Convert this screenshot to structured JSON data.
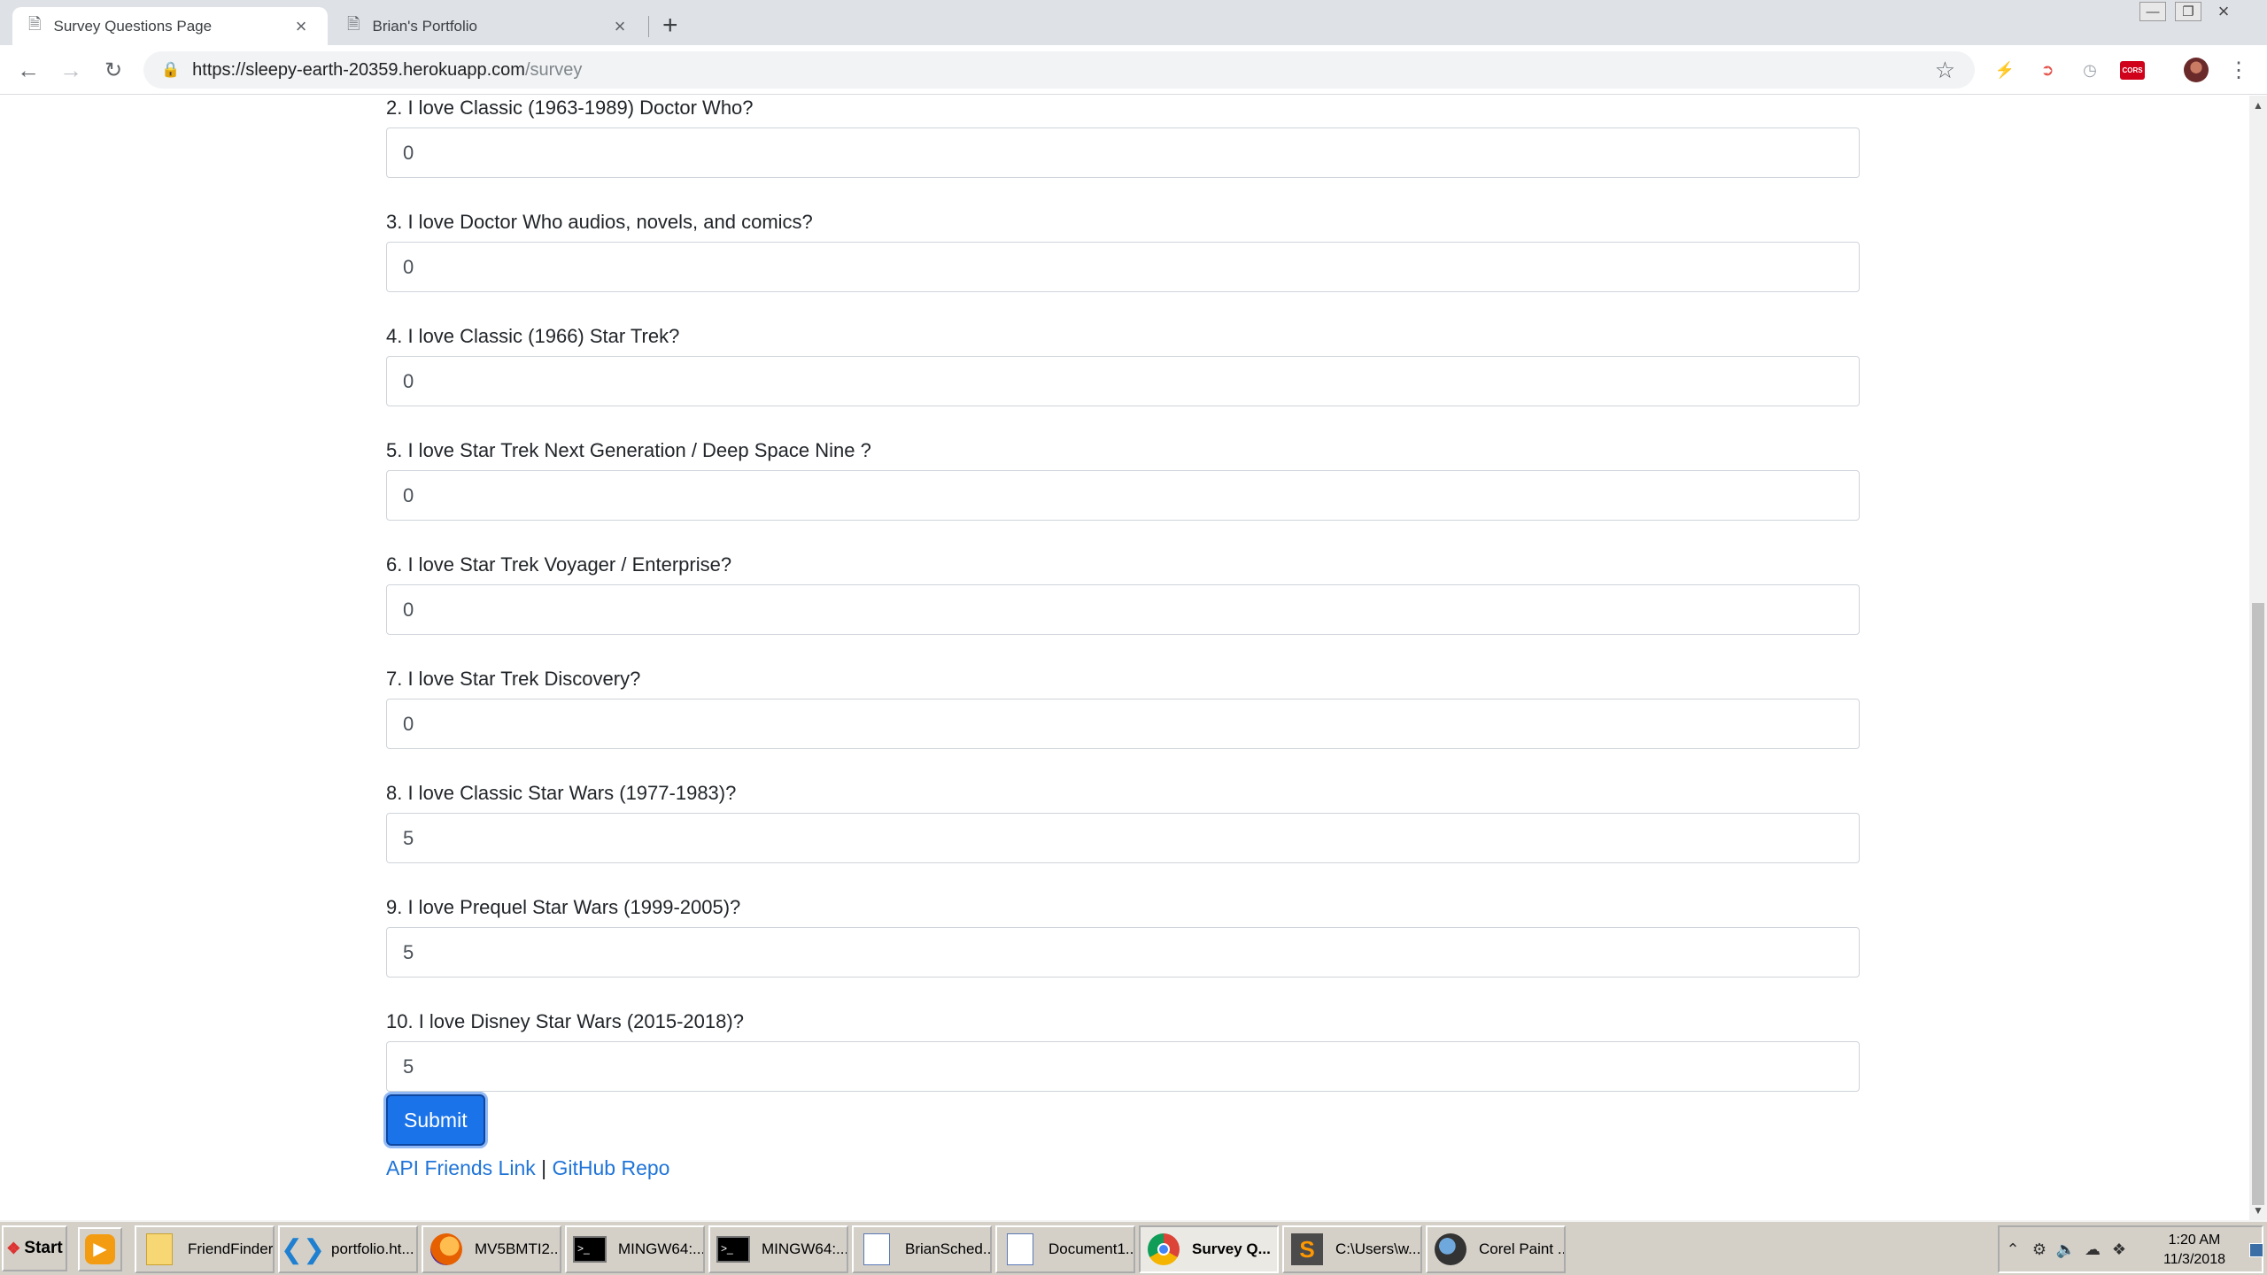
{
  "browser": {
    "tabs": [
      {
        "title": "Survey Questions Page",
        "active": true
      },
      {
        "title": "Brian's Portfolio",
        "active": false
      }
    ],
    "new_tab_label": "+",
    "url_host": "https://sleepy-earth-20359.herokuapp.com",
    "url_path": "/survey",
    "extensions": [
      "bolt-icon",
      "arrow-icon",
      "clock-icon",
      "cors-icon",
      "avatar"
    ],
    "cors_label": "CORS"
  },
  "survey": {
    "questions": [
      {
        "label": "2. I love Classic (1963-1989) Doctor Who?",
        "value": "0"
      },
      {
        "label": "3. I love Doctor Who audios, novels, and comics?",
        "value": "0"
      },
      {
        "label": "4. I love Classic (1966) Star Trek?",
        "value": "0"
      },
      {
        "label": "5. I love Star Trek Next Generation / Deep Space Nine ?",
        "value": "0"
      },
      {
        "label": "6. I love Star Trek Voyager / Enterprise?",
        "value": "0"
      },
      {
        "label": "7. I love Star Trek Discovery?",
        "value": "0"
      },
      {
        "label": "8. I love Classic Star Wars (1977-1983)?",
        "value": "5"
      },
      {
        "label": "9. I love Prequel Star Wars (1999-2005)?",
        "value": "5"
      },
      {
        "label": "10. I love Disney Star Wars (2015-2018)?",
        "value": "5"
      }
    ],
    "submit_label": "Submit",
    "links": {
      "api": "API Friends Link",
      "separator": "|",
      "github": "GitHub Repo"
    }
  },
  "taskbar": {
    "start_label": "Start",
    "items": [
      {
        "label": "FriendFinder",
        "icon": "folder-icon"
      },
      {
        "label": "portfolio.ht...",
        "icon": "vscode-icon"
      },
      {
        "label": "MV5BMTI2...",
        "icon": "firefox-icon"
      },
      {
        "label": "MINGW64:...",
        "icon": "terminal-icon"
      },
      {
        "label": "MINGW64:...",
        "icon": "terminal-icon"
      },
      {
        "label": "BrianSched...",
        "icon": "document-icon"
      },
      {
        "label": "Document1...",
        "icon": "document-icon"
      },
      {
        "label": "Survey Q...",
        "icon": "chrome-icon",
        "active": true
      },
      {
        "label": "C:\\Users\\w...",
        "icon": "sublime-icon"
      },
      {
        "label": "Corel Paint ...",
        "icon": "corel-icon"
      }
    ],
    "clock_time": "1:20 AM",
    "clock_date": "11/3/2018"
  },
  "colors": {
    "link": "#1a73e8",
    "button": "#1a73e8",
    "cors_badge": "#d0021b"
  }
}
